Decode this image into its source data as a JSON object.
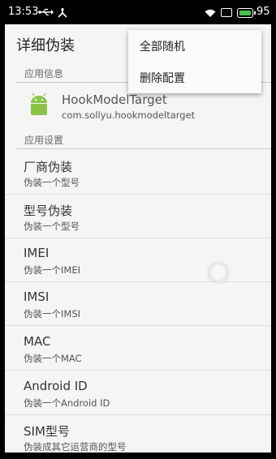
{
  "status_bar": {
    "time": "13:53",
    "battery_level": "95",
    "icons": [
      "usb-icon",
      "share-icon",
      "wifi-icon",
      "sim-icon",
      "battery-icon"
    ],
    "battery_color": "#45c04a"
  },
  "appbar": {
    "title": "详细伪装"
  },
  "overflow_menu": {
    "items": [
      {
        "label": "全部随机"
      },
      {
        "label": "删除配置"
      }
    ]
  },
  "sections": {
    "app_info": "应用信息",
    "app_settings": "应用设置"
  },
  "app_info": {
    "icon": "android-icon",
    "name": "HookModelTarget",
    "package": "com.sollyu.hookmodeltarget",
    "icon_color": "#8bc34a"
  },
  "settings": [
    {
      "title": "厂商伪装",
      "summary": "伪装一个型号"
    },
    {
      "title": "型号伪装",
      "summary": "伪装一个型号"
    },
    {
      "title": "IMEI",
      "summary": "伪装一个IMEI"
    },
    {
      "title": "IMSI",
      "summary": "伪装一个IMSI"
    },
    {
      "title": "MAC",
      "summary": "伪装一个MAC"
    },
    {
      "title": "Android ID",
      "summary": "伪装一个Android ID"
    },
    {
      "title": "SIM型号",
      "summary": "伪装成其它运营商的型号"
    }
  ]
}
